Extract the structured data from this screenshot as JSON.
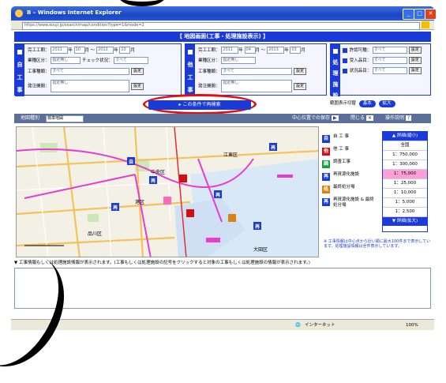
{
  "window": {
    "title": "Windows Internet Explorer",
    "title_prefix": "B",
    "address": "https://www.kouji.jp/search/map/condition?type=1&mode=2"
  },
  "banner": "【 地図画面(工事・処理施設表示) 】",
  "own": {
    "vlabel": "自工事",
    "period_label": "完工工期：",
    "year_from": "2011",
    "year_unit": "年",
    "month_from": "10",
    "month_unit": "月",
    "tilde": "〜",
    "year_to": "2012",
    "month_to": "10",
    "work_type_label": "業種区分：",
    "work_type_value": "指定無し",
    "check_label": "チェック状況：",
    "check_value": "すべて",
    "kind_label": "工事種類：",
    "kind_value": "すべて",
    "orderer_label": "発注機関：",
    "orderer_value": "指定無し",
    "select_btn": "設定"
  },
  "other": {
    "vlabel": "他工事",
    "period_label": "完工工期：",
    "year_from": "2011",
    "month_from": "04",
    "year_to": "2013",
    "month_to": "03",
    "work_type_label": "業種区分：",
    "work_type_value": "指定無し",
    "kind_label": "工事種類：",
    "kind_value": "すべて",
    "orderer_label": "発注機関：",
    "orderer_value": "指定無し",
    "select_btn": "設定"
  },
  "facility": {
    "vlabel": "処理施設",
    "license_label": "許認可種：",
    "license_value": "すべて",
    "item_label": "受入品目：",
    "item_value": "すべて",
    "status_label": "状況品目：",
    "status_value": "すべて",
    "select_btn": "設定"
  },
  "search_button": "この条件で再検索",
  "scale_mode_label": "範囲表示切替",
  "scale_buttons": [
    "基本",
    "拡大"
  ],
  "map_toolbar": {
    "map_type_label": "地図種別",
    "map_type_value": "標準地図",
    "center_btn": "中心位置での保存",
    "close_btn": "閉じる",
    "help_btn": "操作説明"
  },
  "legend": [
    {
      "icon": "自",
      "label": "自 工 事",
      "color": "#1a3bd8"
    },
    {
      "icon": "他",
      "label": "他 工 事",
      "color": "#d01010"
    },
    {
      "icon": "調",
      "label": "調査工事",
      "color": "#18a038"
    },
    {
      "icon": "再",
      "label": "再資源化施設",
      "color": "#1a3bd8"
    },
    {
      "icon": "処",
      "label": "最終処分場",
      "color": "#e08010"
    },
    {
      "icon": "再",
      "label": "再資源化施設 & 最終処分場",
      "color": "#1a3bd8"
    }
  ],
  "scale": {
    "up": "▲ 詳細(縮小)",
    "items": [
      "全国",
      "1：750,000",
      "1：300,000",
      "1：75,000",
      "1：25,000",
      "1：10,000",
      "1：5,000",
      "1：2,500"
    ],
    "selected_index": 3,
    "down": "▼ 詳細(拡大)"
  },
  "note": "※ 工事情報は中心点から近い順に最大100件まで表示しています。処理施設情報は全件表示しています。",
  "message": "▼ 工事情報もしくは処理施設情報が表示されます。(工事もしくは処理施設の記号をクリックすると対象の工事もしくは処理施設の情報が表示されます。)",
  "status": {
    "zone": "インターネット",
    "zoom": "100%"
  },
  "map_labels": [
    "江東区",
    "中央区",
    "港区",
    "品川区",
    "大田区"
  ]
}
